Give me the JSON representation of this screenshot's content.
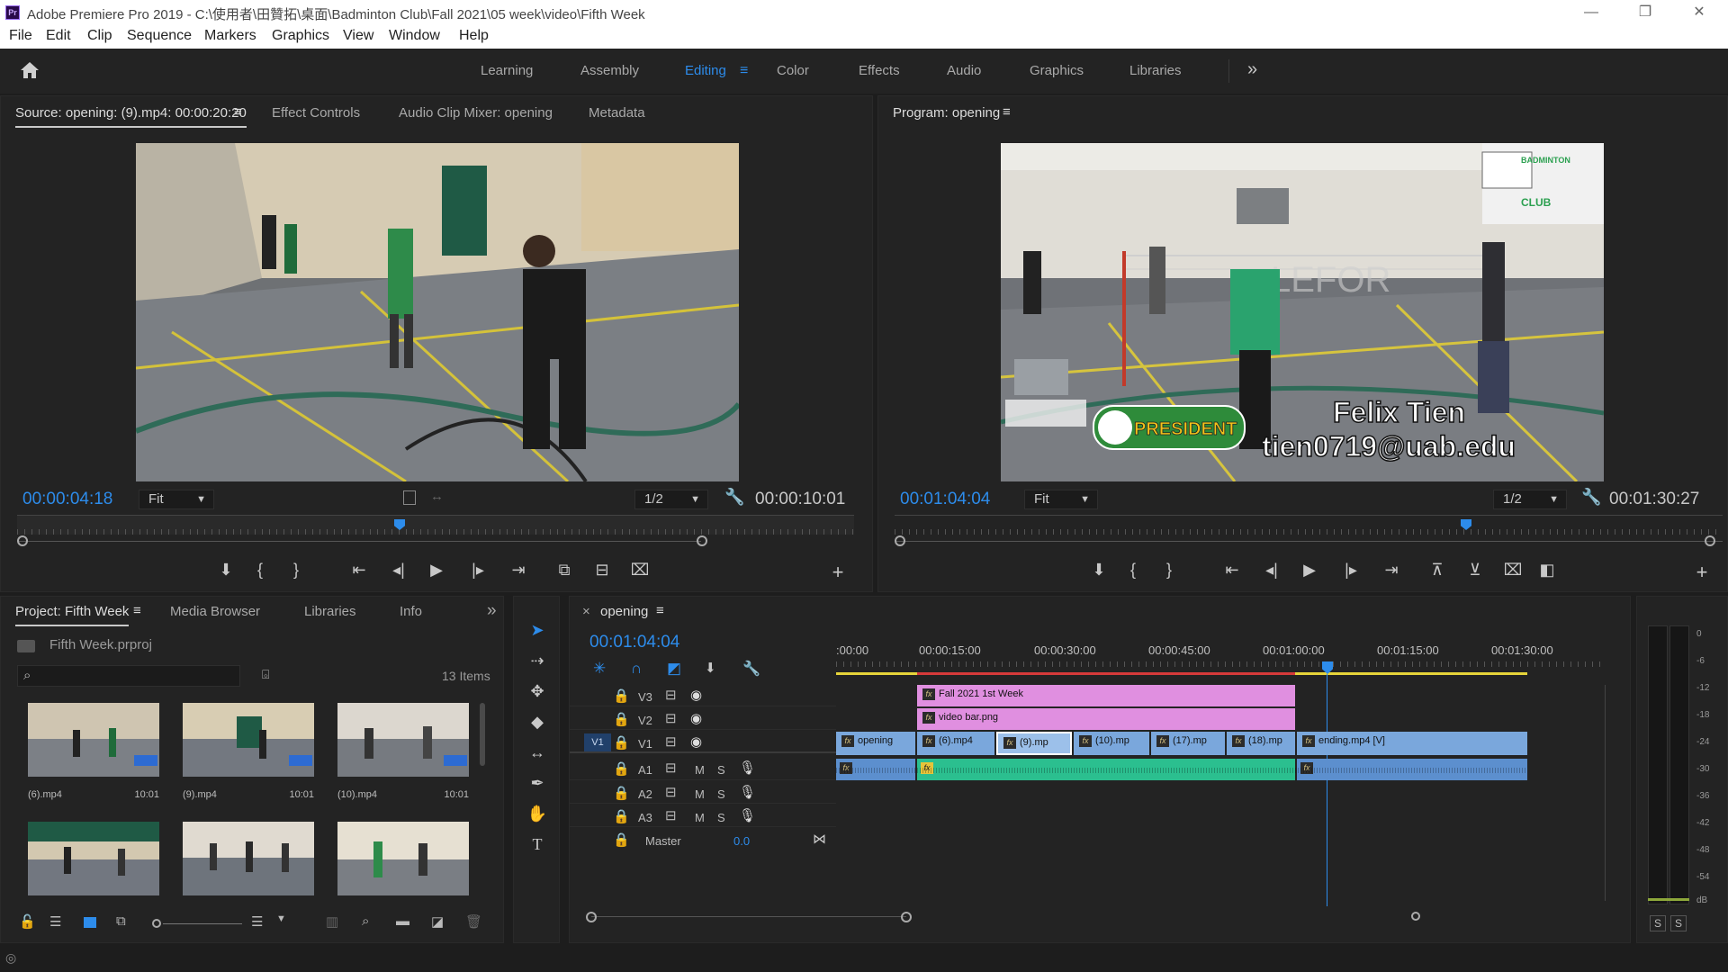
{
  "window": {
    "title": "Adobe Premiere Pro 2019 - C:\\使用者\\田贊拓\\桌面\\Badminton Club\\Fall 2021\\05 week\\video\\Fifth Week",
    "pr_logo": "Pr"
  },
  "menu": [
    "File",
    "Edit",
    "Clip",
    "Sequence",
    "Markers",
    "Graphics",
    "View",
    "Window",
    "Help"
  ],
  "workspaces": {
    "items": [
      "Learning",
      "Assembly",
      "Editing",
      "Color",
      "Effects",
      "Audio",
      "Graphics",
      "Libraries"
    ],
    "active": "Editing",
    "overflow": "»"
  },
  "source": {
    "tabs": [
      "Source: opening: (9).mp4: 00:00:20:20",
      "Effect Controls",
      "Audio Clip Mixer: opening",
      "Metadata"
    ],
    "timecode": "00:00:04:18",
    "zoom": "Fit",
    "resolution": "1/2",
    "duration": "00:00:10:01",
    "playhead": 0.45
  },
  "program": {
    "tab": "Program: opening",
    "timecode": "00:01:04:04",
    "zoom": "Fit",
    "resolution": "1/2",
    "duration": "00:01:30:27",
    "overlay": {
      "badge": "PRESIDENT",
      "name": "Felix Tien",
      "email": "tien0719@uab.edu",
      "logo_top": "BADMINTON",
      "logo_bottom": "CLUB",
      "wall": "LEFOR"
    }
  },
  "project": {
    "tabs": [
      "Project: Fifth Week",
      "Media Browser",
      "Libraries",
      "Info"
    ],
    "file": "Fifth Week.prproj",
    "items_count": "13 Items",
    "search_placeholder": "",
    "items": [
      {
        "name": "(6).mp4",
        "dur": "10:01"
      },
      {
        "name": "(9).mp4",
        "dur": "10:01"
      },
      {
        "name": "(10).mp4",
        "dur": "10:01"
      },
      {
        "name": "",
        "dur": ""
      },
      {
        "name": "",
        "dur": ""
      },
      {
        "name": "",
        "dur": ""
      }
    ]
  },
  "timeline": {
    "tab": "opening",
    "timecode": "00:01:04:04",
    "ruler": [
      ":00:00",
      "00:00:15:00",
      "00:00:30:00",
      "00:00:45:00",
      "00:01:00:00",
      "00:01:15:00",
      "00:01:30:00"
    ],
    "tracks": {
      "video": [
        "V3",
        "V2",
        "V1"
      ],
      "audio": [
        "A1",
        "A2",
        "A3"
      ],
      "master_label": "Master",
      "master_value": "0.0",
      "src_patch": "V1",
      "mute": "M",
      "solo": "S"
    },
    "clips": {
      "v3": "Fall 2021 1st Week",
      "v2": "video bar.png",
      "v1": [
        "opening",
        "(6).mp4",
        "(9).mp",
        "(10).mp",
        "(17).mp",
        "(18).mp",
        "ending.mp4 [V]"
      ],
      "fx": "fx"
    }
  },
  "meter": {
    "labels": [
      "0",
      "-6",
      "-12",
      "-18",
      "-24",
      "-30",
      "-36",
      "-42",
      "-48",
      "-54",
      "dB"
    ],
    "solo": [
      "S",
      "S"
    ]
  },
  "colors": {
    "accent": "#2d8ceb",
    "v3": "#e08fe0",
    "v1": "#7aa7dc",
    "a1": "#2bbf8f"
  }
}
